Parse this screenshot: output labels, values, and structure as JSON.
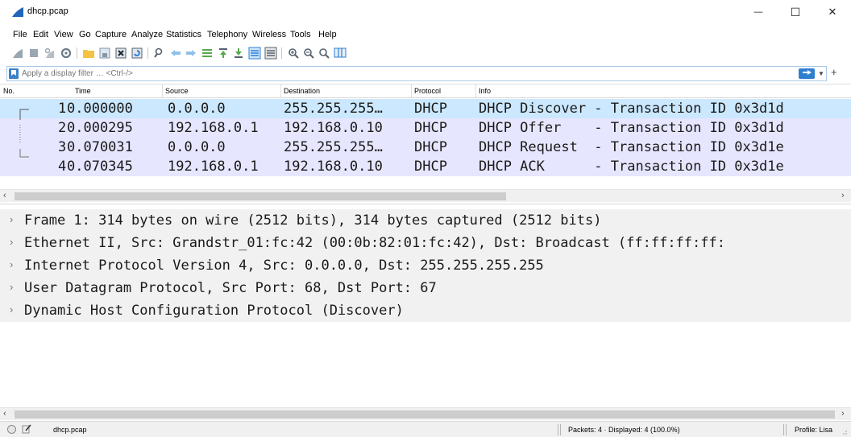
{
  "window": {
    "title": "dhcp.pcap",
    "minimize_glyph": "—",
    "maximize_glyph": "☐",
    "close_glyph": "✕"
  },
  "menu": [
    "File",
    "Edit",
    "View",
    "Go",
    "Capture",
    "Analyze",
    "Statistics",
    "Telephony",
    "Wireless",
    "Tools",
    "Help"
  ],
  "toolbar_icons": [
    "shark-fin-start-icon",
    "stop-capture-icon",
    "restart-capture-icon",
    "capture-options-icon",
    "open-file-icon",
    "save-file-icon",
    "close-file-icon",
    "reload-file-icon",
    "find-packet-icon",
    "go-back-icon",
    "go-forward-icon",
    "go-to-packet-icon",
    "go-first-icon",
    "go-last-icon",
    "autoscroll-icon",
    "colorize-icon",
    "zoom-in-icon",
    "zoom-out-icon",
    "zoom-normal-icon",
    "resize-columns-icon"
  ],
  "filter": {
    "placeholder": "Apply a display filter … <Ctrl-/>",
    "add_label": "+"
  },
  "packet_list": {
    "columns": [
      "No.",
      "Time",
      "Source",
      "Destination",
      "Protocol",
      "Info"
    ],
    "rows": [
      {
        "no": "1",
        "time": "0.000000",
        "source": "0.0.0.0",
        "destination": "255.255.255…",
        "protocol": "DHCP",
        "info": "DHCP Discover - Transaction ID 0x3d1d"
      },
      {
        "no": "2",
        "time": "0.000295",
        "source": "192.168.0.1",
        "destination": "192.168.0.10",
        "protocol": "DHCP",
        "info": "DHCP Offer    - Transaction ID 0x3d1d"
      },
      {
        "no": "3",
        "time": "0.070031",
        "source": "0.0.0.0",
        "destination": "255.255.255…",
        "protocol": "DHCP",
        "info": "DHCP Request  - Transaction ID 0x3d1e"
      },
      {
        "no": "4",
        "time": "0.070345",
        "source": "192.168.0.1",
        "destination": "192.168.0.10",
        "protocol": "DHCP",
        "info": "DHCP ACK      - Transaction ID 0x3d1e"
      }
    ],
    "selected_row": 0
  },
  "details": [
    "Frame 1: 314 bytes on wire (2512 bits), 314 bytes captured (2512 bits)",
    "Ethernet II, Src: Grandstr_01:fc:42 (00:0b:82:01:fc:42), Dst: Broadcast (ff:ff:ff:ff:",
    "Internet Protocol Version 4, Src: 0.0.0.0, Dst: 255.255.255.255",
    "User Datagram Protocol, Src Port: 68, Dst Port: 67",
    "Dynamic Host Configuration Protocol (Discover)"
  ],
  "expander_glyph": "›",
  "scroll": {
    "left": "‹",
    "right": "›"
  },
  "status": {
    "file": "dhcp.pcap",
    "packets": "Packets: 4 · Displayed: 4 (100.0%)",
    "profile": "Profile: Lisa"
  },
  "colors": {
    "selected_row": "#cbe8ff",
    "udp_row": "#e7e6ff",
    "detail_row": "#f1f1f1",
    "accent": "#2f7fd1"
  }
}
